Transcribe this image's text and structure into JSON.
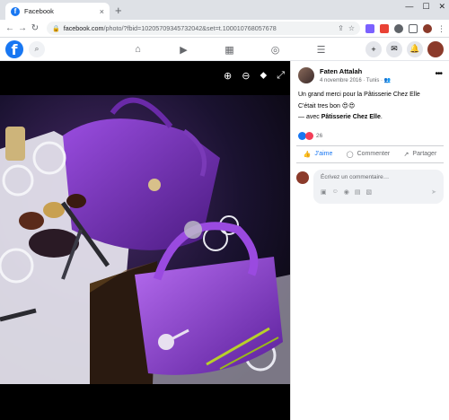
{
  "browser": {
    "tab_title": "Facebook",
    "tab_close": "×",
    "new_tab": "+",
    "url_host": "facebook.com",
    "url_path": "/photo/?fbid=10205709345732042&set=t.100010768057678",
    "min": "—",
    "max": "☐",
    "close": "✕"
  },
  "fb": {
    "logo": "f"
  },
  "post": {
    "author": "Faten Attalah",
    "date": "4 novembre 2016 · Tunis · ",
    "line1": "Un grand merci pour la Pâtisserie Chez Elle",
    "line2": "C'était tres bon 😍😍",
    "with_prefix": "— avec ",
    "with_name": "Pâtisserie Chez Elle",
    "with_suffix": ".",
    "reaction_count": "26",
    "like_label": "J'aime",
    "comment_label": "Commenter",
    "share_label": "Partager",
    "comment_placeholder": "Écrivez un commentaire…"
  },
  "colors": {
    "brand": "#1877f2",
    "purple_bag": "#7a2fc0"
  }
}
